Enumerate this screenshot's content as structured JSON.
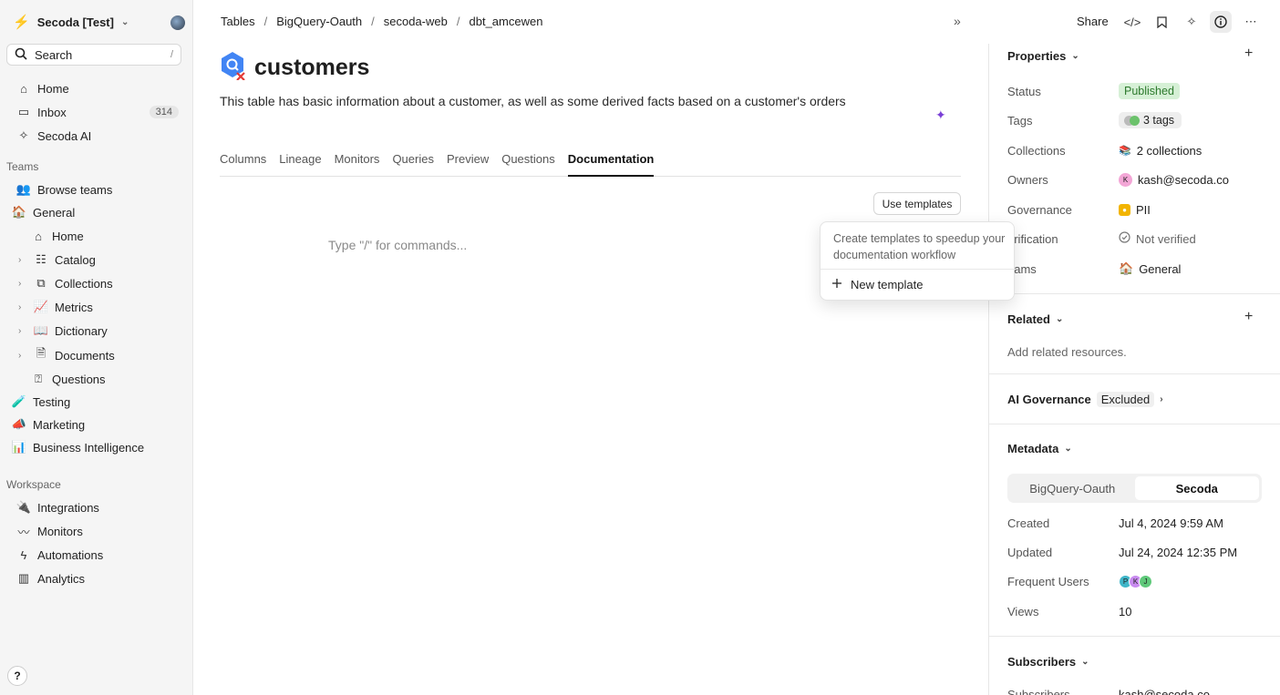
{
  "workspace": {
    "name": "Secoda [Test]"
  },
  "search": {
    "label": "Search",
    "shortcut": "/"
  },
  "nav": {
    "home": "Home",
    "inbox": "Inbox",
    "inbox_count": "314",
    "ai": "Secoda AI"
  },
  "teams_label": "Teams",
  "teams": {
    "browse": "Browse teams",
    "general": "General",
    "general_items": {
      "home": "Home",
      "catalog": "Catalog",
      "collections": "Collections",
      "metrics": "Metrics",
      "dictionary": "Dictionary",
      "documents": "Documents",
      "questions": "Questions"
    },
    "testing": "Testing",
    "marketing": "Marketing",
    "bi": "Business Intelligence"
  },
  "workspace_label": "Workspace",
  "workspace_items": {
    "integrations": "Integrations",
    "monitors": "Monitors",
    "automations": "Automations",
    "analytics": "Analytics"
  },
  "help": "?",
  "breadcrumb": [
    "Tables",
    "BigQuery-Oauth",
    "secoda-web",
    "dbt_amcewen"
  ],
  "breadcrumb_sep": "/",
  "page": {
    "title": "customers",
    "description": "This table has basic information about a customer, as well as some derived facts based on a customer's orders",
    "tabs": [
      "Columns",
      "Lineage",
      "Monitors",
      "Queries",
      "Preview",
      "Questions",
      "Documentation"
    ],
    "active_tab": "Documentation",
    "use_templates": "Use templates",
    "editor_placeholder": "Type \"/\" for commands..."
  },
  "popover": {
    "text": "Create templates to speedup your documentation workflow",
    "new_template": "New template"
  },
  "topbar": {
    "share": "Share"
  },
  "properties": {
    "heading": "Properties",
    "rows": {
      "status": {
        "label": "Status",
        "value": "Published"
      },
      "tags": {
        "label": "Tags",
        "value": "3 tags"
      },
      "collections": {
        "label": "Collections",
        "value": "2 collections"
      },
      "owners": {
        "label": "Owners",
        "value": "kash@secoda.co",
        "avatar": "K"
      },
      "governance": {
        "label": "Governance",
        "value": "PII"
      },
      "verification": {
        "label": "erification",
        "value": "Not verified"
      },
      "teams": {
        "label": "eams",
        "value": "General"
      }
    }
  },
  "related": {
    "heading": "Related",
    "empty": "Add related resources."
  },
  "ai_governance": {
    "heading": "AI Governance",
    "value": "Excluded"
  },
  "metadata": {
    "heading": "Metadata",
    "segments": [
      "BigQuery-Oauth",
      "Secoda"
    ],
    "selected_segment": "Secoda",
    "created": {
      "label": "Created",
      "value": "Jul 4, 2024 9:59 AM"
    },
    "updated": {
      "label": "Updated",
      "value": "Jul 24, 2024 12:35 PM"
    },
    "frequent_users": {
      "label": "Frequent Users",
      "avatars": [
        "P",
        "K",
        "J"
      ]
    },
    "views": {
      "label": "Views",
      "value": "10"
    }
  },
  "subscribers": {
    "heading": "Subscribers",
    "label": "Subscribers",
    "value": "kash@secoda.co"
  },
  "colors": {
    "accent": "#f05a5a",
    "published_bg": "#d6f0d6",
    "published_fg": "#2d7a2d",
    "ai_purple": "#7a3fd6",
    "bigquery_blue": "#4285f4"
  }
}
